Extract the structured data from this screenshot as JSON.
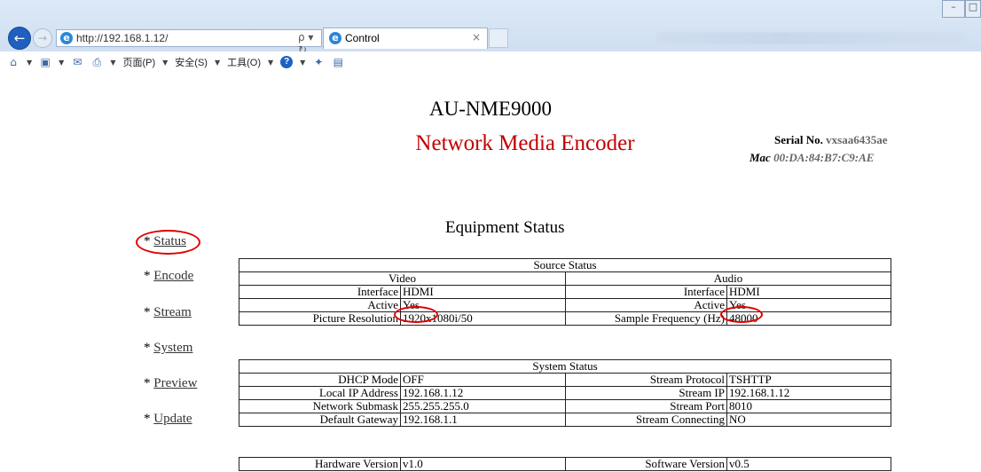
{
  "browser": {
    "url": "http://192.168.1.12/",
    "tab_title": "Control",
    "tab_close": "×",
    "addr_tools": "ρ ▾ ↻",
    "menu": {
      "page": "页面(P)",
      "safety": "安全(S)",
      "tools": "工具(O)"
    }
  },
  "header": {
    "product_name": "AU-NME9000",
    "product_subtitle": "Network Media Encoder",
    "serial_label": "Serial No.",
    "serial_value": "vxsaa6435ae",
    "mac_label": "Mac",
    "mac_value": "00:DA:84:B7:C9:AE"
  },
  "page_title": "Equipment Status",
  "nav": {
    "bullet": "* ",
    "items": [
      "Status",
      "Encode",
      "Stream",
      "System",
      "Preview",
      "Update"
    ]
  },
  "source_status": {
    "title": "Source Status",
    "video_header": "Video",
    "audio_header": "Audio",
    "video": [
      {
        "label": "Interface",
        "value": "HDMI"
      },
      {
        "label": "Active",
        "value": "Yes"
      },
      {
        "label": "Picture Resolution",
        "value": "1920x1080i/50"
      }
    ],
    "audio": [
      {
        "label": "Interface",
        "value": "HDMI"
      },
      {
        "label": "Active",
        "value": "Yes"
      },
      {
        "label": "Sample Frequency (Hz)",
        "value": "48000"
      }
    ]
  },
  "system_status": {
    "title": "System Status",
    "left": [
      {
        "label": "DHCP Mode",
        "value": "OFF"
      },
      {
        "label": "Local IP Address",
        "value": "192.168.1.12"
      },
      {
        "label": "Network Submask",
        "value": "255.255.255.0"
      },
      {
        "label": "Default Gateway",
        "value": "192.168.1.1"
      }
    ],
    "right": [
      {
        "label": "Stream Protocol",
        "value": "TSHTTP"
      },
      {
        "label": "Stream IP",
        "value": "192.168.1.12"
      },
      {
        "label": "Stream Port",
        "value": "8010"
      },
      {
        "label": "Stream Connecting",
        "value": "NO"
      }
    ]
  },
  "version": {
    "hardware_label": "Hardware Version",
    "hardware_value": "v1.0",
    "software_label": "Software Version",
    "software_value": "v0.5"
  },
  "colors": {
    "accent_red": "#c40000",
    "annotation_circle": "#e00000",
    "link": "#333333"
  }
}
